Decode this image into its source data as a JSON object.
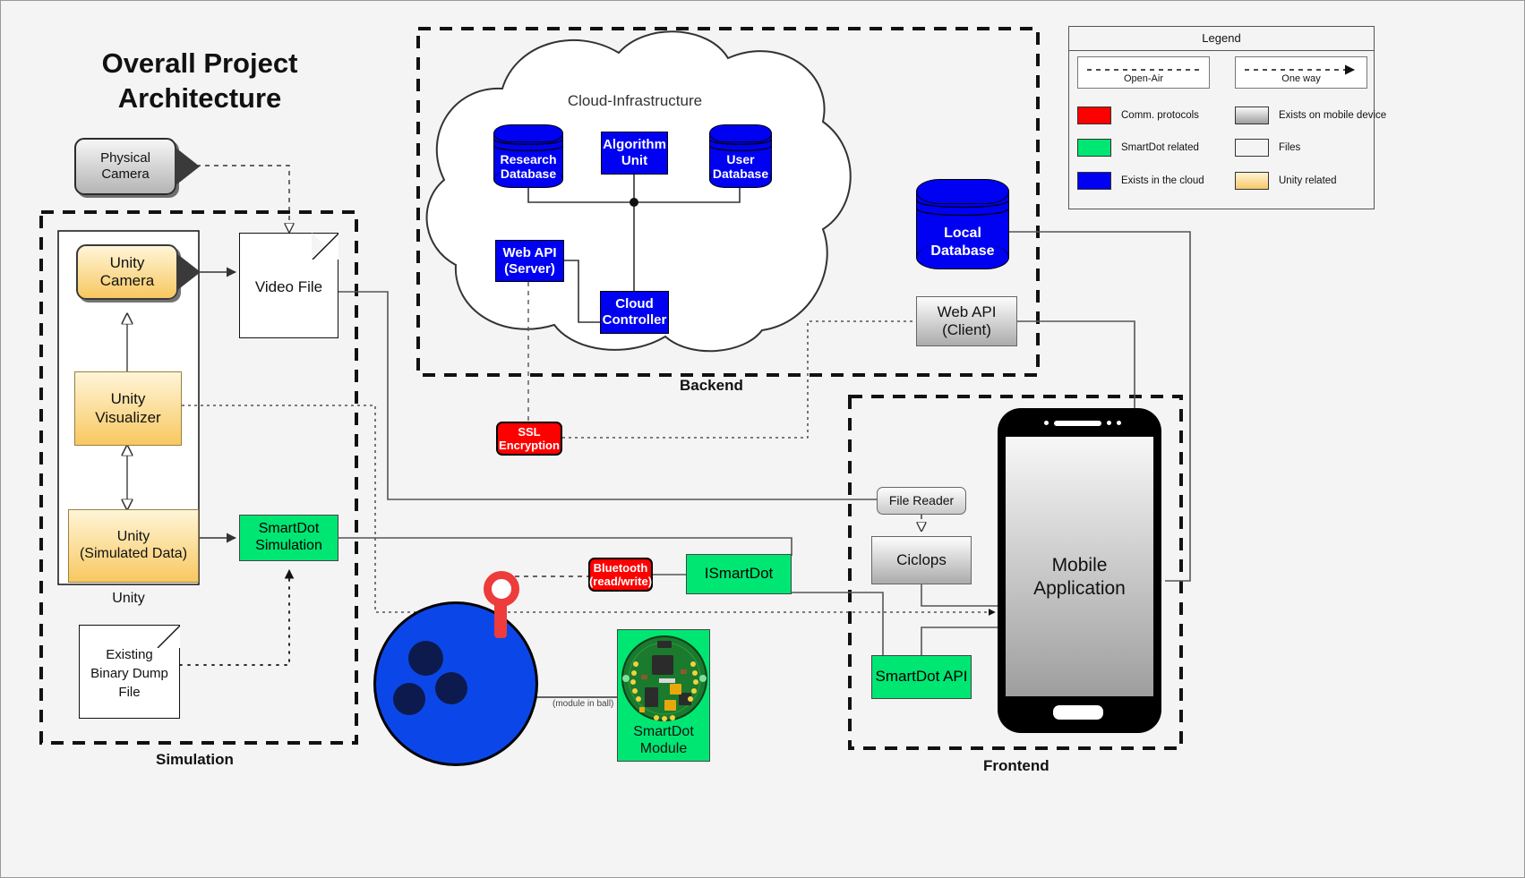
{
  "title": "Overall Project Architecture",
  "groups": {
    "backend": "Backend",
    "simulation": "Simulation",
    "frontend": "Frontend",
    "unity": "Unity",
    "cloud": "Cloud-Infrastructure"
  },
  "legend": {
    "title": "Legend",
    "line_items": [
      {
        "label": "Open-Air",
        "style": "dashed-line"
      },
      {
        "label": "One way",
        "style": "dashed-arrow"
      }
    ],
    "swatches": [
      {
        "label": "Comm. protocols",
        "color": "#ff0000"
      },
      {
        "label": "Exists on mobile device",
        "color": "#c6c6c6"
      },
      {
        "label": "SmartDot related",
        "color": "#00e673"
      },
      {
        "label": "Files",
        "color": "#f4f4f4"
      },
      {
        "label": "Exists in the cloud",
        "color": "#0000f2"
      },
      {
        "label": "Unity related",
        "color": "#fbd584"
      }
    ]
  },
  "nodes": {
    "physical_camera": "Physical\nCamera",
    "unity_camera": "Unity\nCamera",
    "unity_visualizer": "Unity\nVisualizer",
    "unity_simulated_data": "Unity\n(Simulated Data)",
    "video_file": "Video File",
    "existing_binary_dump": "Existing\nBinary Dump\nFile",
    "smartdot_simulation": "SmartDot\nSimulation",
    "research_database": "Research\nDatabase",
    "algorithm_unit": "Algorithm\nUnit",
    "user_database": "User\nDatabase",
    "web_api_server": "Web API\n(Server)",
    "cloud_controller": "Cloud\nController",
    "ssl_encryption": "SSL\nEncryption",
    "local_database": "Local\nDatabase",
    "web_api_client": "Web API\n(Client)",
    "file_reader": "File Reader",
    "ciclops": "Ciclops",
    "smartdot_api": "SmartDot API",
    "ismartdot": "ISmartDot",
    "bluetooth": "Bluetooth\n(read/write)",
    "smartdot_module": "SmartDot\nModule",
    "mobile_application": "Mobile\nApplication",
    "module_in_ball": "(module in ball)"
  },
  "colors": {
    "cloud_blue": "#0000f2",
    "smartdot_green": "#00e673",
    "comm_red": "#ff0000",
    "unity_amber": "#fbd584",
    "mobile_grey": "#c6c6c6",
    "canvas": "#f4f4f4"
  }
}
